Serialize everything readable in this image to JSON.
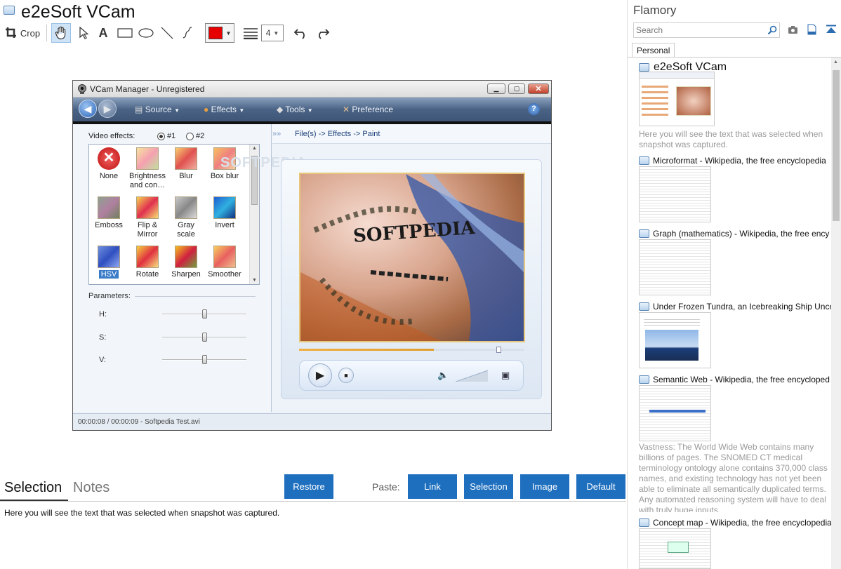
{
  "main": {
    "title": "e2eSoft VCam",
    "toolbar": {
      "crop_label": "Crop",
      "line_width": "4"
    },
    "colors": {
      "accent": "#1f6fbf",
      "pen": "#e60000"
    }
  },
  "vcam": {
    "window_title": "VCam Manager - Unregistered",
    "nav": [
      "Source",
      "Effects",
      "Tools",
      "Preference"
    ],
    "video_effects_label": "Video effects:",
    "radio1": "#1",
    "radio2": "#2",
    "breadcrumb": "File(s) -> Effects -> Paint",
    "effects": [
      "None",
      "Brightness and con…",
      "Blur",
      "Box blur",
      "Emboss",
      "Flip & Mirror",
      "Gray scale",
      "Invert",
      "HSV",
      "Rotate",
      "Sharpen",
      "Smoother"
    ],
    "parameters_label": "Parameters:",
    "params": [
      "H:",
      "S:",
      "V:"
    ],
    "status": "00:00:08 / 00:00:09 - Softpedia Test.avi",
    "watermark": "SOFTPEDIA",
    "video_text": "SOFTPEDIA"
  },
  "bottom": {
    "tab_selection": "Selection",
    "tab_notes": "Notes",
    "restore": "Restore",
    "paste_label": "Paste:",
    "link": "Link",
    "selection": "Selection",
    "image": "Image",
    "default": "Default",
    "text": "Here you will see the text that was selected when snapshot was captured."
  },
  "sidebar": {
    "app_name": "Flamory",
    "search_placeholder": "Search",
    "tab": "Personal",
    "entries": [
      {
        "title": "e2eSoft VCam",
        "desc": "Here you will see the text that was selected when snapshot was captured."
      },
      {
        "title": "Microformat - Wikipedia, the free encyclopedia"
      },
      {
        "title": "Graph (mathematics) - Wikipedia, the free ency"
      },
      {
        "title": "Under Frozen Tundra, an Icebreaking Ship Unco"
      },
      {
        "title": "Semantic Web - Wikipedia, the free encycloped",
        "desc": "Vastness: The World Wide Web contains many billions of pages. The SNOMED CT medical terminology ontology alone contains 370,000 class names, and existing technology has not yet been able to eliminate all semantically duplicated terms. Any automated reasoning system will have to deal with truly huge inputs."
      },
      {
        "title": "Concept map - Wikipedia, the free encyclopedia"
      }
    ]
  }
}
